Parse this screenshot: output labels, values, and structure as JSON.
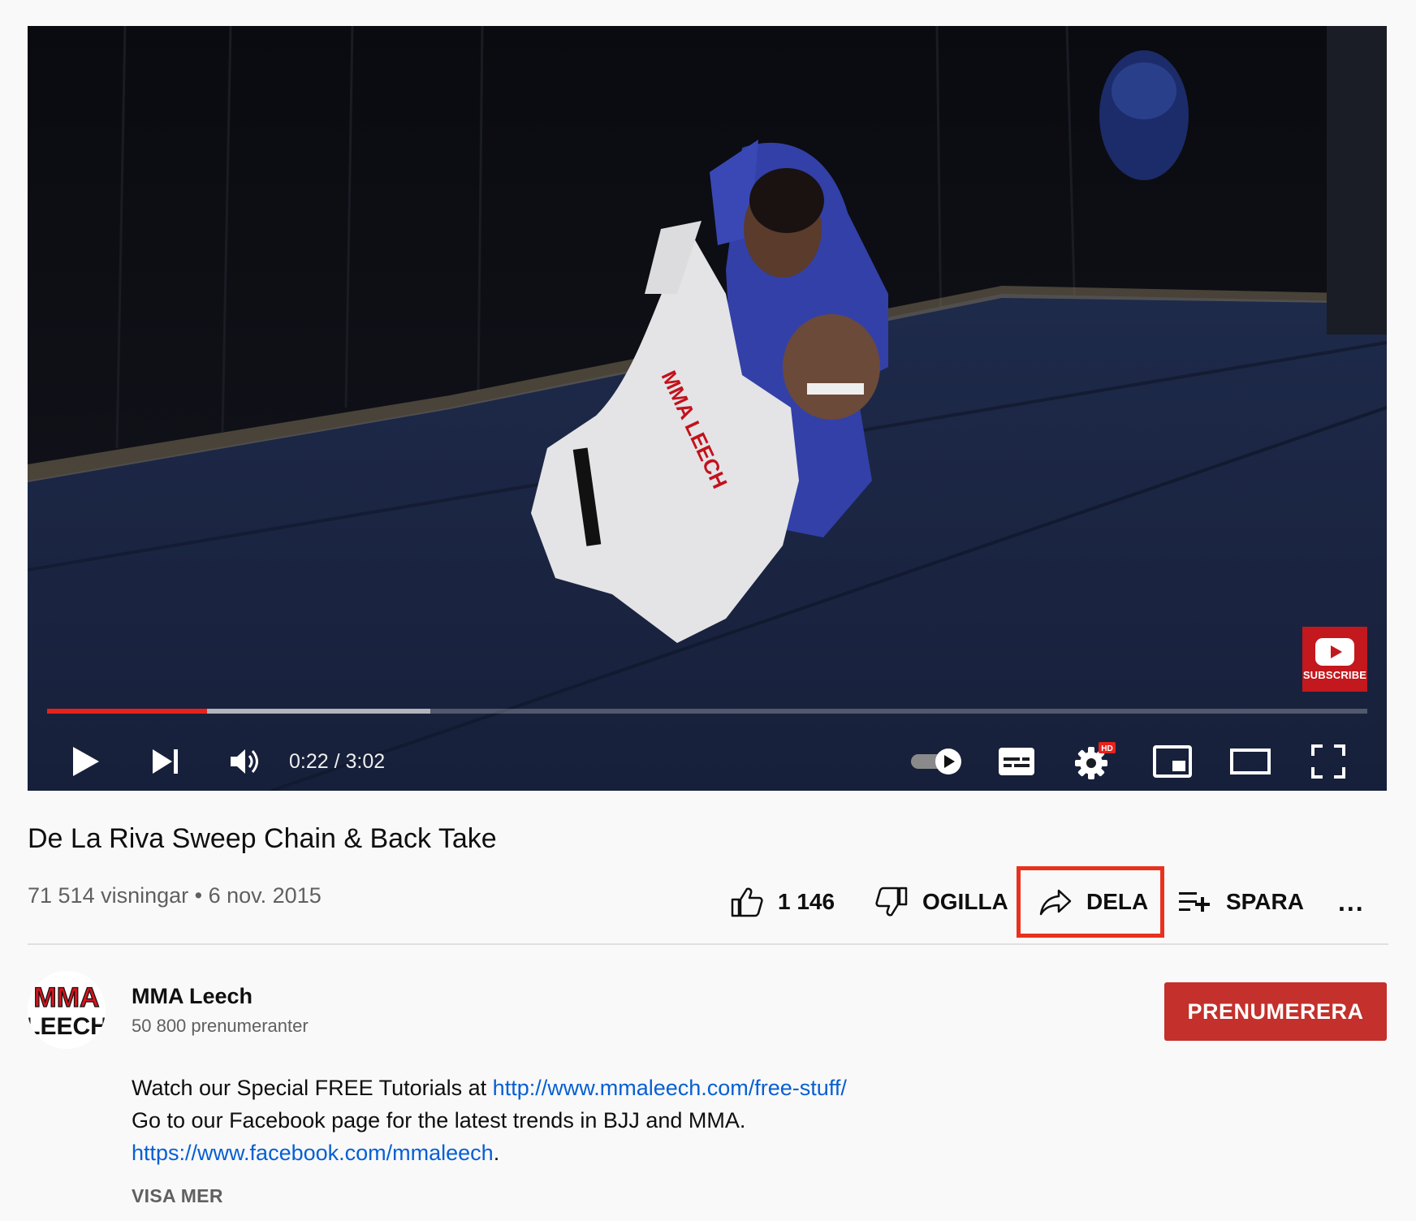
{
  "player": {
    "current_time": "0:22",
    "duration": "3:02",
    "time_separator": " / ",
    "progress_fraction": 0.121,
    "buffered_fraction": 0.29,
    "watermark_label": "SUBSCRIBE",
    "quality_badge": "HD",
    "accent_color": "#e8221b",
    "controls": [
      "play-icon",
      "next-icon",
      "volume-icon",
      "autoplay-toggle",
      "captions-icon",
      "settings-icon",
      "miniplayer-icon",
      "theater-icon",
      "fullscreen-icon"
    ]
  },
  "video": {
    "title": "De La Riva Sweep Chain & Back Take",
    "views": "71 514 visningar",
    "date": "6 nov. 2015",
    "meta_separator": " • "
  },
  "actions": {
    "like_count": "1 146",
    "dislike_label": "OGILLA",
    "share_label": "DELA",
    "save_label": "SPARA",
    "more_label": "..."
  },
  "channel": {
    "name": "MMA Leech",
    "subscribers": "50 800 prenumeranter",
    "avatar_text_top": "MMA",
    "avatar_text_bottom": "LEECH",
    "subscribe_label": "PRENUMERERA",
    "subscribe_color": "#c4302b"
  },
  "description": {
    "line1_text": "Watch our Special FREE Tutorials at ",
    "line1_link": "http://www.mmaleech.com/free-stuff/",
    "line2_text": "Go to our Facebook page for the latest trends in BJJ and MMA.",
    "line3_link": "https://www.facebook.com/mmaleech",
    "line3_suffix": ".",
    "show_more_label": "VISA MER"
  },
  "highlight_color": "#e8321e"
}
